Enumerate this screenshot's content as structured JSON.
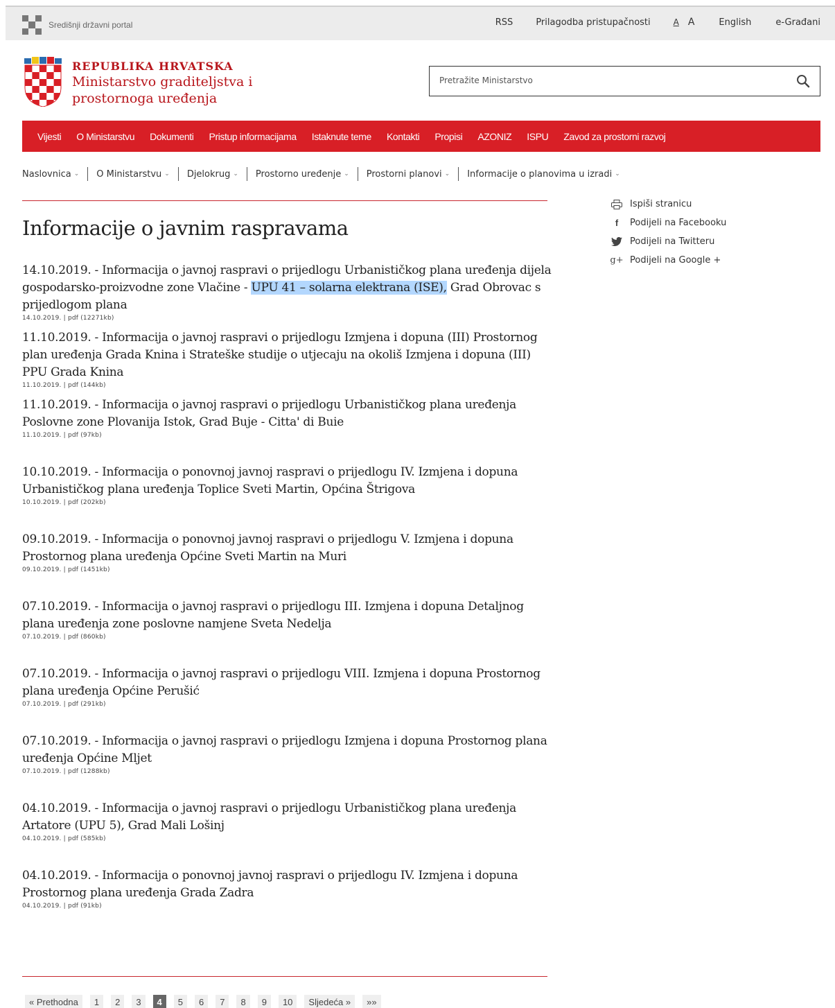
{
  "topbar": {
    "portal_label": "Središnji državni portal",
    "links": {
      "rss": "RSS",
      "accessibility": "Prilagodba pristupačnosti",
      "font_small": "A",
      "font_large": "A",
      "english": "English",
      "egradani": "e-Građani"
    }
  },
  "header": {
    "republika": "REPUBLIKA HRVATSKA",
    "ministry_line1": "Ministarstvo graditeljstva i",
    "ministry_line2": "prostornoga uređenja",
    "search_placeholder": "Pretražite Ministarstvo"
  },
  "main_nav": [
    "Vijesti",
    "O Ministarstvu",
    "Dokumenti",
    "Pristup informacijama",
    "Istaknute teme",
    "Kontakti",
    "Propisi",
    "AZONIZ",
    "ISPU",
    "Zavod za prostorni razvoj"
  ],
  "breadcrumb": [
    "Naslovnica",
    "O Ministarstvu",
    "Djelokrug",
    "Prostorno uređenje",
    "Prostorni planovi",
    "Informacije o planovima u izradi"
  ],
  "page_title": "Informacije o javnim raspravama",
  "items": [
    {
      "title_before": "14.10.2019. - Informacija o javnoj raspravi o prijedlogu Urbanističkog plana uređenja dijela gospodarsko-proizvodne zone Vlačine - ",
      "title_highlight": "UPU 41 – solarna elektrana (ISE),",
      "title_after": " Grad Obrovac s prijedlogom plana",
      "meta": "14.10.2019. | pdf (12271kb)"
    },
    {
      "title_before": "11.10.2019. - Informacija o javnoj raspravi o prijedlogu Izmjena i dopuna (III) Prostornog plan uređenja Grada Knina i Strateške studije o utjecaju na okoliš Izmjena i dopuna (III) PPU Grada Knina",
      "meta": "11.10.2019. | pdf (144kb)"
    },
    {
      "title_before": "11.10.2019. - Informacija o javnoj raspravi o prijedlogu Urbanističkog plana uređenja Poslovne zone Plovanija Istok, Grad Buje - Citta' di Buie",
      "meta": "11.10.2019. | pdf (97kb)"
    },
    {
      "title_before": "10.10.2019. - Informacija o ponovnoj javnoj raspravi o prijedlogu IV. Izmjena i dopuna Urbanističkog plana uređenja Toplice Sveti Martin, Općina Štrigova",
      "meta": "10.10.2019. | pdf (202kb)"
    },
    {
      "title_before": "09.10.2019. - Informacija o ponovnoj javnoj raspravi o prijedlogu V. Izmjena i dopuna Prostornog plana uređenja Općine Sveti Martin na Muri",
      "meta": "09.10.2019. | pdf (1451kb)"
    },
    {
      "title_before": "07.10.2019. - Informacija o javnoj raspravi o prijedlogu III. Izmjena i dopuna Detaljnog plana uređenja zone poslovne namjene Sveta Nedelja",
      "meta": "07.10.2019. | pdf (860kb)"
    },
    {
      "title_before": "07.10.2019. - Informacija o javnoj raspravi o prijedlogu VIII. Izmjena i dopuna Prostornog plana uređenja Općine Perušić",
      "meta": "07.10.2019. | pdf (291kb)"
    },
    {
      "title_before": "07.10.2019. - Informacija o javnoj raspravi o prijedlogu Izmjena i dopuna Prostornog plana uređenja Općine Mljet",
      "meta": "07.10.2019. | pdf (1288kb)"
    },
    {
      "title_before": "04.10.2019. - Informacija o javnoj raspravi o prijedlogu Urbanističkog plana uređenja Artatore (UPU 5), Grad Mali Lošinj",
      "meta": "04.10.2019. | pdf (585kb)"
    },
    {
      "title_before": "04.10.2019. - Informacija o ponovnoj javnoj raspravi o prijedlogu IV. Izmjena i dopuna Prostornog plana uređenja Grada Zadra",
      "meta": "04.10.2019. | pdf (91kb)"
    }
  ],
  "share": {
    "print": "Ispiši stranicu",
    "facebook": "Podijeli na Facebooku",
    "twitter": "Podijeli na Twitteru",
    "google": "Podijeli na Google +"
  },
  "pagination": {
    "prev": "« Prethodna",
    "pages": [
      "1",
      "2",
      "3",
      "4",
      "5",
      "6",
      "7",
      "8",
      "9",
      "10"
    ],
    "current": "4",
    "next": "Sljedeća »",
    "last": "»»"
  },
  "colors": {
    "brand_red": "#d81f26",
    "highlight": "#b3d7fe"
  }
}
